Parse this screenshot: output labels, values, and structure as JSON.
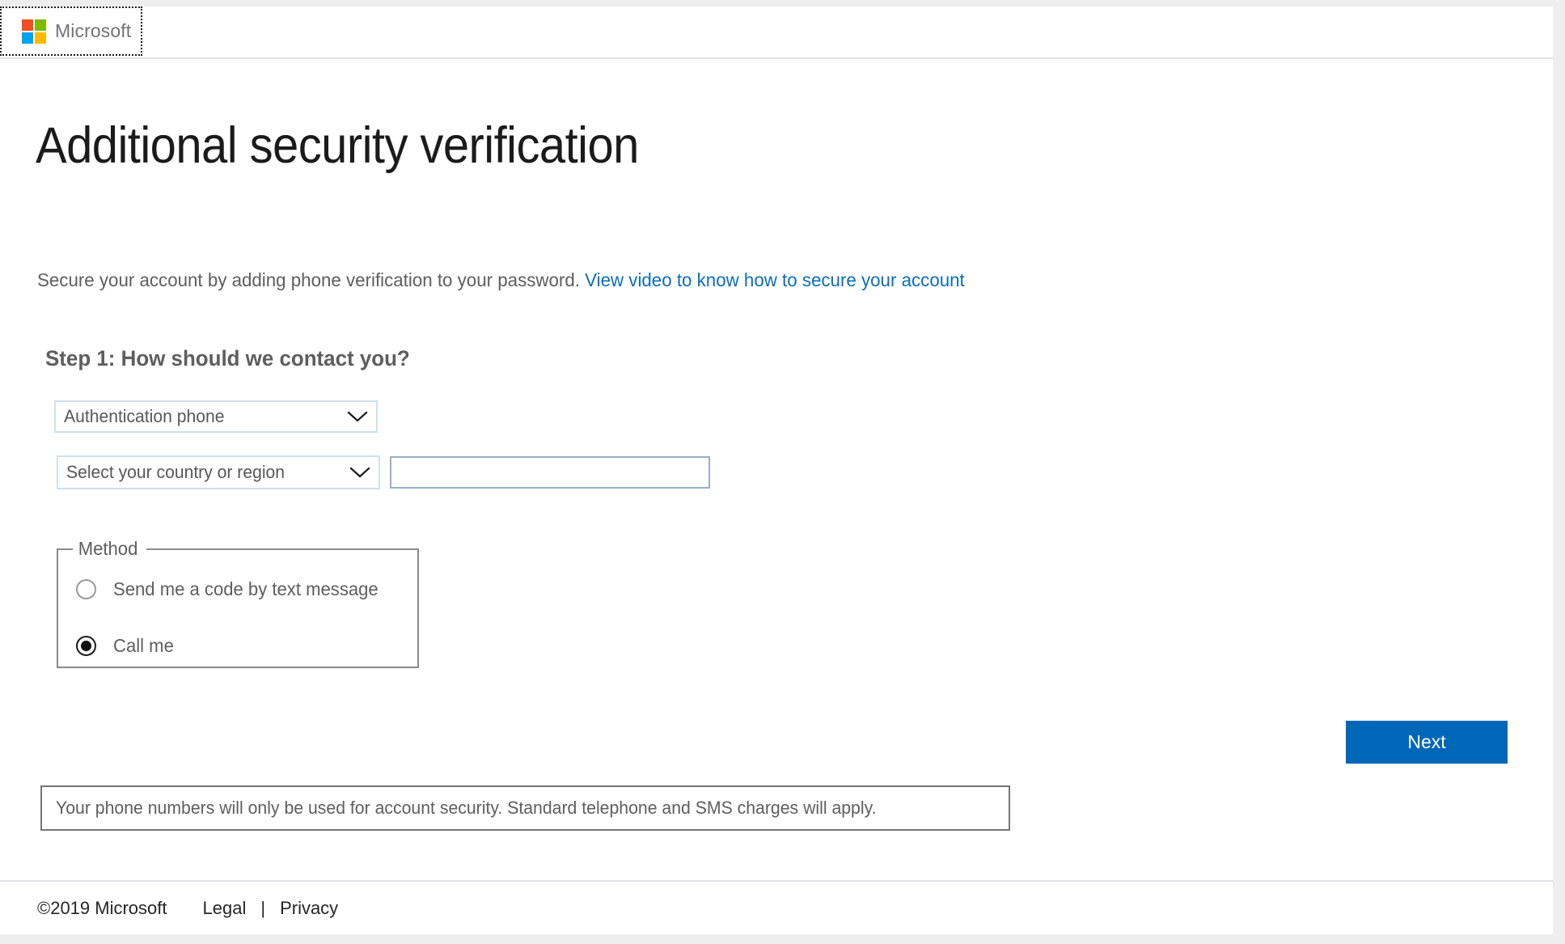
{
  "header": {
    "brand_name": "Microsoft",
    "logo": {
      "icon": "microsoft-logo-icon",
      "colors": {
        "top_left": "#f25022",
        "top_right": "#7fba00",
        "bottom_left": "#00a4ef",
        "bottom_right": "#ffb900"
      }
    }
  },
  "main": {
    "page_title": "Additional security verification",
    "lede_text": "Secure your account by adding phone verification to your password.",
    "lede_link": "View video to know how to secure your account",
    "step_title": "Step 1: How should we contact you?",
    "method_select": {
      "selected": "Authentication phone",
      "chevron_icon": "chevron-down-icon"
    },
    "country_select": {
      "selected": "Select your country or region",
      "chevron_icon": "chevron-down-icon"
    },
    "phone_input": {
      "value": "",
      "placeholder": ""
    },
    "method_fieldset": {
      "legend": "Method",
      "options": [
        {
          "label": "Send me a code by text message",
          "selected": false
        },
        {
          "label": "Call me",
          "selected": true
        }
      ]
    },
    "next_button": {
      "label": "Next",
      "color": "#0067b8"
    },
    "note": "Your phone numbers will only be used for account security. Standard telephone and SMS charges will apply."
  },
  "footer": {
    "copyright": "©2019 Microsoft",
    "legal": "Legal",
    "separator": "|",
    "privacy": "Privacy"
  }
}
